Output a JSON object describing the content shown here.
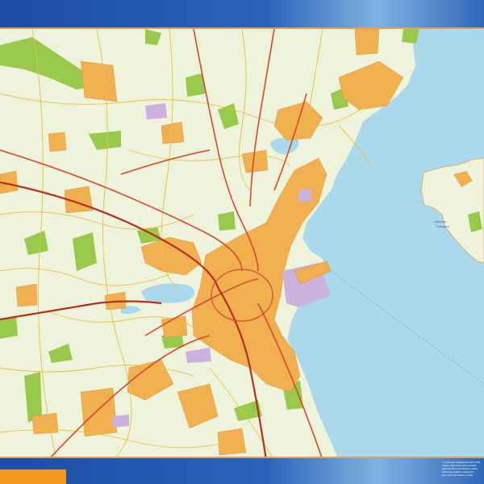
{
  "map": {
    "sea_labels": [
      "Hjelmsø",
      "Kalvøgen"
    ],
    "copyright_lines": [
      "© Copyright Ottawaguild 1997-2011",
      "These maps have been created",
      "reproduction is prohibited, unless",
      "electronic, digital or otherwise",
      "For more information consult"
    ]
  },
  "colors": {
    "frame_blue": "#1d4fa3",
    "accent_orange": "#f39a1e",
    "land": "#eef3dc",
    "urban": "#f1b04f",
    "forest": "#98c94b",
    "water": "#a9d9ea",
    "industrial": "#c9b3de",
    "road_major": "#d9482a",
    "road_minor": "#e9c23a"
  }
}
